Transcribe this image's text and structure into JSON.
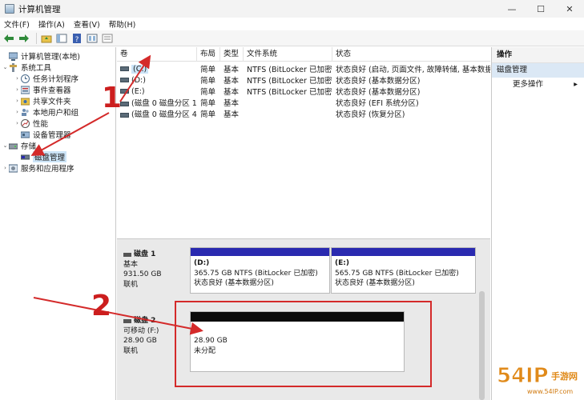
{
  "window": {
    "title": "计算机管理",
    "min": "—",
    "max": "☐",
    "close": "✕"
  },
  "menu": [
    "文件(F)",
    "操作(A)",
    "查看(V)",
    "帮助(H)"
  ],
  "tree": {
    "root": "计算机管理(本地)",
    "system_tools": "系统工具",
    "system_children": [
      "任务计划程序",
      "事件查看器",
      "共享文件夹",
      "本地用户和组",
      "性能",
      "设备管理器"
    ],
    "storage": "存储",
    "disk_mgmt": "磁盘管理",
    "services": "服务和应用程序"
  },
  "list": {
    "columns": [
      "卷",
      "布局",
      "类型",
      "文件系统",
      "状态"
    ],
    "rows": [
      {
        "volume": "(C:)",
        "layout": "简单",
        "type": "基本",
        "fs": "NTFS (BitLocker 已加密)",
        "status": "状态良好 (启动, 页面文件, 故障转储, 基本数据分",
        "selected": true
      },
      {
        "volume": "(D:)",
        "layout": "简单",
        "type": "基本",
        "fs": "NTFS (BitLocker 已加密)",
        "status": "状态良好 (基本数据分区)"
      },
      {
        "volume": "(E:)",
        "layout": "简单",
        "type": "基本",
        "fs": "NTFS (BitLocker 已加密)",
        "status": "状态良好 (基本数据分区)"
      },
      {
        "volume": "(磁盘 0 磁盘分区 1)",
        "layout": "简单",
        "type": "基本",
        "fs": "",
        "status": "状态良好 (EFI 系统分区)"
      },
      {
        "volume": "(磁盘 0 磁盘分区 4)",
        "layout": "简单",
        "type": "基本",
        "fs": "",
        "status": "状态良好 (恢复分区)"
      }
    ]
  },
  "disks": {
    "disk1": {
      "name": "磁盘 1",
      "kind": "基本",
      "size": "931.50 GB",
      "state": "联机",
      "partitions": [
        {
          "title": "(D:)",
          "detail": "365.75 GB NTFS (BitLocker 已加密)",
          "status": "状态良好 (基本数据分区)"
        },
        {
          "title": "(E:)",
          "detail": "565.75 GB NTFS (BitLocker 已加密)",
          "status": "状态良好 (基本数据分区)"
        }
      ]
    },
    "disk2": {
      "name": "磁盘 2",
      "kind": "可移动 (F:)",
      "size": "28.90 GB",
      "state": "联机",
      "unalloc_size": "28.90 GB",
      "unalloc_label": "未分配"
    }
  },
  "actions": {
    "header": "操作",
    "section": "磁盘管理",
    "more": "更多操作",
    "more_arrow": "▸"
  },
  "annotations": {
    "one": "1",
    "two": "2"
  },
  "watermark": {
    "text": "54IP手游网",
    "url": "www.54IP.com"
  },
  "colors": {
    "primary_partition": "#2a2ab0",
    "unallocated": "#0a0a0a",
    "annotation": "#d42a2a",
    "selection": "#cce4f7"
  }
}
